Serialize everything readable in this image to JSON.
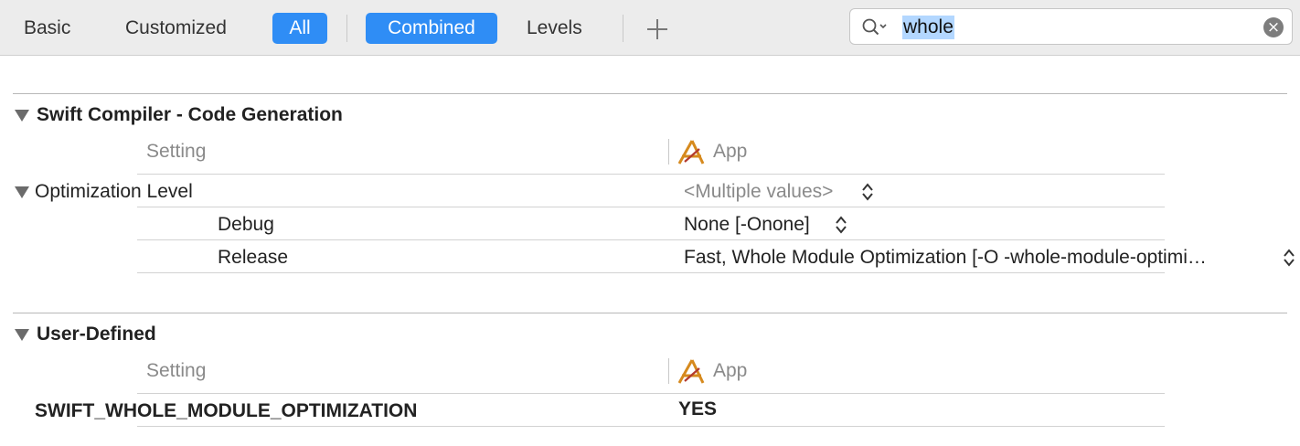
{
  "toolbar": {
    "tabs": [
      "Basic",
      "Customized",
      "All",
      "Combined",
      "Levels"
    ],
    "add_icon": "plus-icon"
  },
  "search": {
    "value": "whole",
    "icon": "search-icon",
    "clear_icon": "clear-circle-icon"
  },
  "sections": [
    {
      "title": "Swift Compiler - Code Generation",
      "header": {
        "setting": "Setting",
        "target": "App"
      },
      "rows": [
        {
          "name": "Optimization Level",
          "value": "<Multiple values>"
        },
        {
          "name": "Debug",
          "value": "None [-Onone]"
        },
        {
          "name": "Release",
          "value": "Fast, Whole Module Optimization  [-O -whole-module-optimi…"
        }
      ]
    },
    {
      "title": "User-Defined",
      "header": {
        "setting": "Setting",
        "target": "App"
      },
      "rows": [
        {
          "name": "SWIFT_WHOLE_MODULE_OPTIMIZATION",
          "value": "YES"
        }
      ]
    }
  ],
  "colors": {
    "accent": "#2f8df5",
    "selection": "#b3d7ff"
  }
}
